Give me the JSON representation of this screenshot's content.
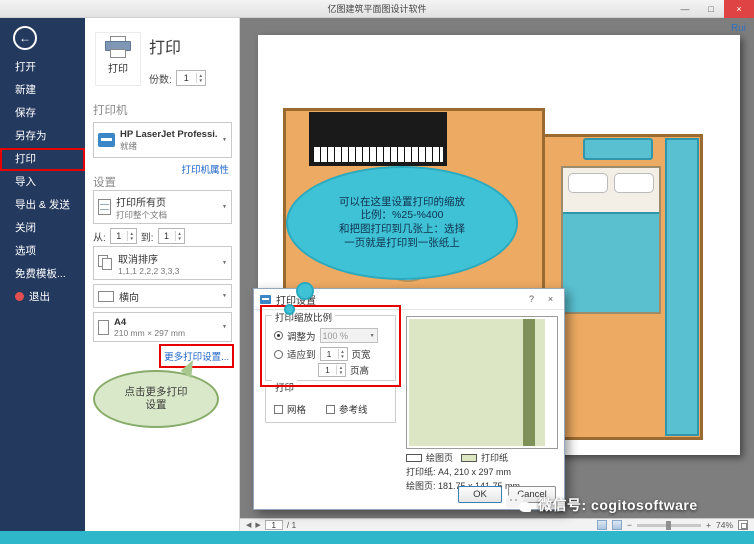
{
  "icons": {
    "back": "←",
    "caret": "▼",
    "spin_up": "▲",
    "spin_down": "▼",
    "minimize": "—",
    "maximize": "□",
    "close": "×",
    "help": "?",
    "nav_prev": "◀",
    "nav_next": "▶",
    "zoom_out": "−",
    "zoom_in": "+"
  },
  "titlebar": {
    "title": "亿图建筑平面图设计软件",
    "user": "Rui"
  },
  "sidebar": {
    "items": [
      {
        "label": "打开"
      },
      {
        "label": "新建"
      },
      {
        "label": "保存"
      },
      {
        "label": "另存为"
      },
      {
        "label": "打印"
      },
      {
        "label": "导入"
      },
      {
        "label": "导出 & 发送"
      },
      {
        "label": "关闭"
      },
      {
        "label": "选项"
      },
      {
        "label": "免费模板..."
      },
      {
        "label": "退出"
      }
    ]
  },
  "print_panel": {
    "heading": "打印",
    "print_button_label": "打印",
    "copies_label": "份数:",
    "copies_value": "1",
    "printer_section": "打印机",
    "printer_name": "HP LaserJet Professi...",
    "printer_status": "就绪",
    "printer_properties_link": "打印机属性",
    "settings_section": "设置",
    "range_title": "打印所有页",
    "range_sub": "打印整个文档",
    "from_label": "从:",
    "from_value": "1",
    "to_label": "到:",
    "to_value": "1",
    "collate_title": "取消排序",
    "collate_sub": "1,1,1  2,2,2  3,3,3",
    "orientation": "横向",
    "paper_name": "A4",
    "paper_size": "210 mm × 297 mm",
    "more_settings_link": "更多打印设置...",
    "tip_bubble": "点击更多打印\n设置"
  },
  "canvas": {
    "cloud_tip": "可以在这里设置打印的缩放\n比例：%25-%400\n和把图打印到几张上：选择\n一页就是打印到一张纸上"
  },
  "dialog": {
    "title": "打印设置",
    "zoom_group_label": "打印缩放比例",
    "adjust_label": "调整为",
    "adjust_value": "100 %",
    "fit_label": "适应到",
    "fit_wide_value": "1",
    "fit_wide_unit": "页宽",
    "fit_tall_value": "1",
    "fit_tall_unit": "页高",
    "print_group_label": "打印",
    "grid_label": "网格",
    "guides_label": "参考线",
    "legend_drawing": "绘图页",
    "legend_paper": "打印纸",
    "paper_info": "打印纸: A4, 210 x 297 mm",
    "drawing_info": "绘图页: 181.75 x 141.75 mm",
    "ok_label": "OK",
    "cancel_label": "Cancel"
  },
  "statusbar": {
    "page_value": "1",
    "page_total": "/ 1",
    "zoom_percent": "74%"
  },
  "watermark": {
    "text": "微信号: cogitosoftware"
  }
}
